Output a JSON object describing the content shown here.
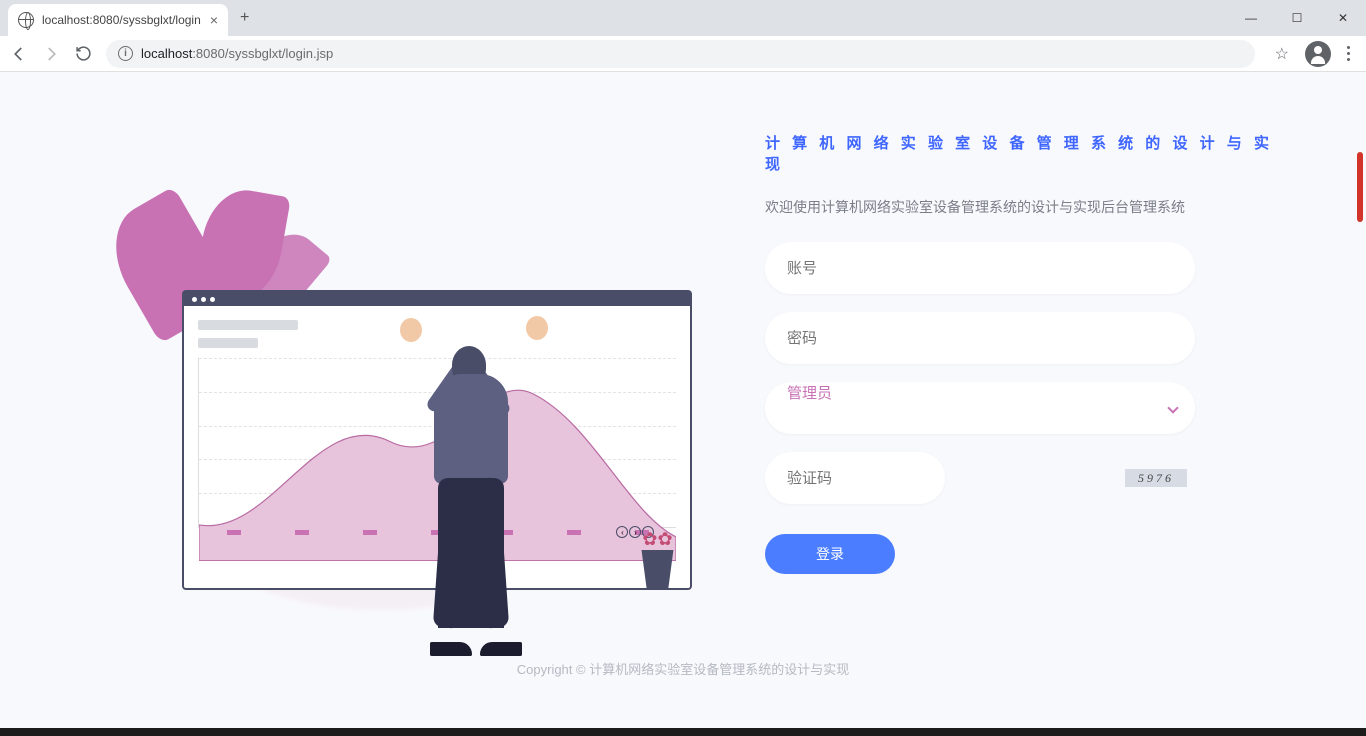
{
  "browser": {
    "tab_title": "localhost:8080/syssbglxt/login",
    "url_display_host": "localhost",
    "url_display_path": ":8080/syssbglxt/login.jsp"
  },
  "page": {
    "heading": "计 算 机 网 络 实 验 室 设 备 管 理 系 统 的 设 计 与 实 现",
    "welcome": "欢迎使用计算机网络实验室设备管理系统的设计与实现后台管理系统",
    "form": {
      "username_placeholder": "账号",
      "password_placeholder": "密码",
      "role_selected": "管理员",
      "captcha_placeholder": "验证码",
      "captcha_value": "5976",
      "login_label": "登录"
    },
    "copyright": "Copyright © 计算机网络实验室设备管理系统的设计与实现"
  }
}
